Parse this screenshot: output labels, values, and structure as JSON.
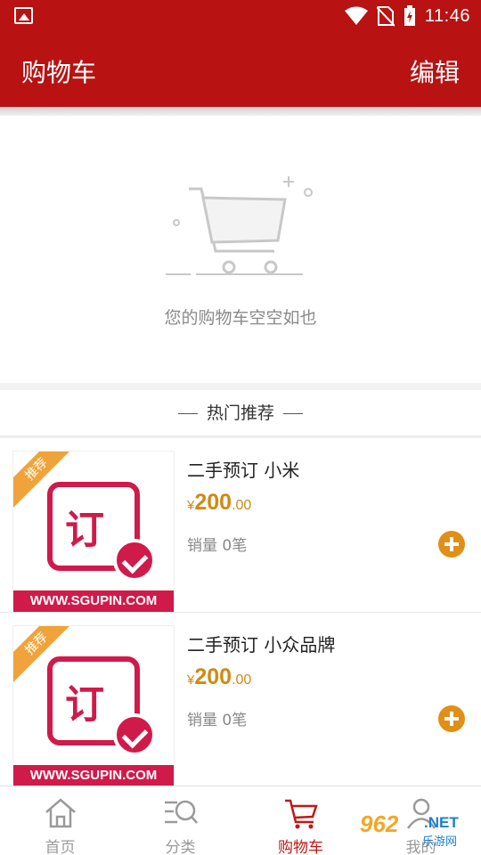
{
  "status_bar": {
    "time": "11:46"
  },
  "header": {
    "title": "购物车",
    "edit_label": "编辑"
  },
  "empty_cart": {
    "message": "您的购物车空空如也"
  },
  "recommend": {
    "title": "热门推荐",
    "items": [
      {
        "name": "二手预订 小米",
        "currency": "¥",
        "price_int": "200",
        "price_dec": ".00",
        "sales": "销量 0笔",
        "badge": "推荐",
        "thumb_char": "订",
        "thumb_url": "WWW.SGUPIN.COM"
      },
      {
        "name": "二手预订 小众品牌",
        "currency": "¥",
        "price_int": "200",
        "price_dec": ".00",
        "sales": "销量 0笔",
        "badge": "推荐",
        "thumb_char": "订",
        "thumb_url": "WWW.SGUPIN.COM"
      }
    ]
  },
  "tabbar": {
    "items": [
      {
        "label": "首页",
        "icon": "home-icon"
      },
      {
        "label": "分类",
        "icon": "category-search-icon"
      },
      {
        "label": "购物车",
        "icon": "cart-icon",
        "active": true
      },
      {
        "label": "我的",
        "icon": "user-icon"
      }
    ]
  },
  "watermark": {
    "num": "962",
    "net": ".NET",
    "cn": "乐游网"
  },
  "colors": {
    "brand": "#b81212",
    "price": "#d08a12",
    "accent_add": "#e08f17",
    "tab_active": "#c01818"
  }
}
